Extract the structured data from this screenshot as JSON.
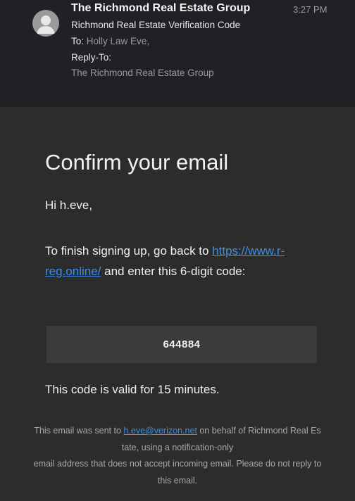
{
  "header": {
    "sender_name": "The Richmond Real Estate Group",
    "time": "3:27 PM",
    "subject": "Richmond Real Estate Verification Code",
    "to_label": "To:",
    "to_value": "Holly Law Eve,",
    "reply_to_label": "Reply-To:",
    "reply_to_value": "The Richmond Real Estate Group",
    "avatar_icon": "person-icon"
  },
  "body": {
    "title": "Confirm your email",
    "greeting": "Hi h.eve,",
    "instructions_before_link": "To finish signing up, go back to ",
    "link_text": "https://www.r-reg.online/",
    "instructions_after_link": " and enter this 6-digit code:",
    "code": "644884",
    "validity": "This code is valid for 15 minutes."
  },
  "footer": {
    "line1_before_link": "This email was sent to ",
    "line1_link": "h.eve@verizon.net",
    "line1_after_link": " on behalf of Richmond Real Es",
    "line2": "tate, using a notification-only",
    "line3": "email address that does not accept incoming email. Please do not reply to",
    "line4": "this email."
  },
  "colors": {
    "background": "#2c2c2c",
    "header_background": "#202124",
    "link": "#3d8de8",
    "code_box": "#3b3b3b"
  }
}
